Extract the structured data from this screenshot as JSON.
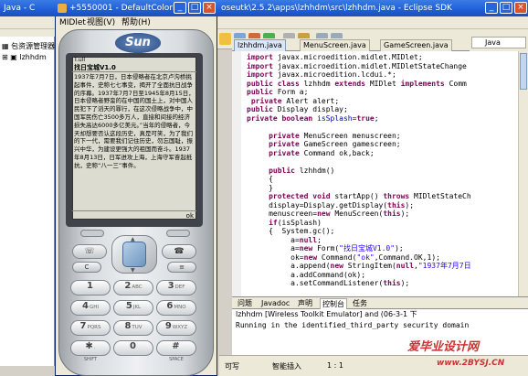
{
  "eclipse": {
    "title_left": "Java - C",
    "title_right": "oseutk\\2.5.2\\apps\\lzhhdm\\src\\lzhhdm.java - Eclipse SDK",
    "perspective_label": "Java",
    "package_tree": [
      {
        "label": "包资源管理器"
      },
      {
        "label": "lzhhdm"
      }
    ],
    "editor_tabs": [
      {
        "label": "lzhhdm.java",
        "active": true
      },
      {
        "label": "MenuScreen.java",
        "active": false
      },
      {
        "label": "GameScreen.java",
        "active": false
      }
    ],
    "code_lines": [
      {
        "segments": [
          {
            "k": "kw",
            "t": "import"
          },
          {
            "k": "",
            "t": " javax.microedition.midlet.MIDlet;"
          }
        ]
      },
      {
        "segments": [
          {
            "k": "kw",
            "t": "import"
          },
          {
            "k": "",
            "t": " javax.microedition.midlet.MIDletStateChange"
          }
        ]
      },
      {
        "segments": [
          {
            "k": "kw",
            "t": "import"
          },
          {
            "k": "",
            "t": " javax.microedition.lcdui.*;"
          }
        ]
      },
      {
        "segments": [
          {
            "k": "kw",
            "t": "public class"
          },
          {
            "k": "",
            "t": " lzhhdm "
          },
          {
            "k": "kw",
            "t": "extends"
          },
          {
            "k": "",
            "t": " MIDlet "
          },
          {
            "k": "kw",
            "t": "implements"
          },
          {
            "k": "",
            "t": " Comm"
          }
        ]
      },
      {
        "segments": [
          {
            "k": "kw",
            "t": "public"
          },
          {
            "k": "",
            "t": " Form a;"
          }
        ]
      },
      {
        "segments": [
          {
            "k": "",
            "t": " "
          },
          {
            "k": "kw",
            "t": "private"
          },
          {
            "k": "",
            "t": " Alert alert;"
          }
        ]
      },
      {
        "segments": [
          {
            "k": "kw",
            "t": "public"
          },
          {
            "k": "",
            "t": " Display display;"
          }
        ]
      },
      {
        "segments": [
          {
            "k": "kw",
            "t": "private boolean"
          },
          {
            "k": "fld",
            "t": " isSplash"
          },
          {
            "k": "",
            "t": "="
          },
          {
            "k": "kw",
            "t": "true"
          },
          {
            "k": "",
            "t": ";"
          }
        ]
      },
      {
        "segments": [
          {
            "k": "",
            "t": ""
          }
        ]
      },
      {
        "segments": [
          {
            "k": "",
            "t": "     "
          },
          {
            "k": "kw",
            "t": "private"
          },
          {
            "k": "",
            "t": " MenuScreen menuscreen;"
          }
        ]
      },
      {
        "segments": [
          {
            "k": "",
            "t": "     "
          },
          {
            "k": "kw",
            "t": "private"
          },
          {
            "k": "",
            "t": " GameScreen gamescreen;"
          }
        ]
      },
      {
        "segments": [
          {
            "k": "",
            "t": "     "
          },
          {
            "k": "kw",
            "t": "private"
          },
          {
            "k": "",
            "t": " Command ok,back;"
          }
        ]
      },
      {
        "segments": [
          {
            "k": "",
            "t": ""
          }
        ]
      },
      {
        "segments": [
          {
            "k": "",
            "t": "     "
          },
          {
            "k": "kw",
            "t": "public"
          },
          {
            "k": "",
            "t": " lzhhdm()"
          }
        ]
      },
      {
        "segments": [
          {
            "k": "",
            "t": "     {"
          }
        ]
      },
      {
        "segments": [
          {
            "k": "",
            "t": "     }"
          }
        ]
      },
      {
        "segments": [
          {
            "k": "",
            "t": "     "
          },
          {
            "k": "kw",
            "t": "protected void"
          },
          {
            "k": "",
            "t": " startApp() "
          },
          {
            "k": "kw",
            "t": "throws"
          },
          {
            "k": "",
            "t": " MIDletStateCh"
          }
        ]
      },
      {
        "segments": [
          {
            "k": "",
            "t": "     display=Display.getDisplay("
          },
          {
            "k": "kw",
            "t": "this"
          },
          {
            "k": "",
            "t": ");"
          }
        ]
      },
      {
        "segments": [
          {
            "k": "",
            "t": "     menuscreen="
          },
          {
            "k": "kw",
            "t": "new"
          },
          {
            "k": "",
            "t": " MenuScreen("
          },
          {
            "k": "kw",
            "t": "this"
          },
          {
            "k": "",
            "t": ");"
          }
        ]
      },
      {
        "segments": [
          {
            "k": "",
            "t": "     "
          },
          {
            "k": "kw",
            "t": "if"
          },
          {
            "k": "",
            "t": "(isSplash)"
          }
        ]
      },
      {
        "segments": [
          {
            "k": "",
            "t": "     {  System.gc();"
          }
        ]
      },
      {
        "segments": [
          {
            "k": "",
            "t": "          a="
          },
          {
            "k": "kw",
            "t": "null"
          },
          {
            "k": "",
            "t": ";"
          }
        ]
      },
      {
        "segments": [
          {
            "k": "",
            "t": "          a="
          },
          {
            "k": "kw",
            "t": "new"
          },
          {
            "k": "",
            "t": " Form("
          },
          {
            "k": "str",
            "t": "\"找日宝城V1.0\""
          },
          {
            "k": "",
            "t": ");"
          }
        ]
      },
      {
        "segments": [
          {
            "k": "",
            "t": "          ok="
          },
          {
            "k": "kw",
            "t": "new"
          },
          {
            "k": "",
            "t": " Command("
          },
          {
            "k": "str",
            "t": "\"ok\""
          },
          {
            "k": "",
            "t": ",Command.OK,1);"
          }
        ]
      },
      {
        "segments": [
          {
            "k": "",
            "t": "          a.append("
          },
          {
            "k": "kw",
            "t": "new"
          },
          {
            "k": "",
            "t": " StringItem("
          },
          {
            "k": "kw",
            "t": "null"
          },
          {
            "k": "",
            "t": ","
          },
          {
            "k": "str",
            "t": "\"1937年7月7日"
          }
        ]
      },
      {
        "segments": [
          {
            "k": "",
            "t": "          a.addCommand(ok);"
          }
        ]
      },
      {
        "segments": [
          {
            "k": "",
            "t": "          a.setCommandListener("
          },
          {
            "k": "kw",
            "t": "this"
          },
          {
            "k": "",
            "t": ");"
          }
        ]
      }
    ],
    "console_tabs": [
      {
        "label": "问题",
        "active": false
      },
      {
        "label": "Javadoc",
        "active": false
      },
      {
        "label": "声明",
        "active": false
      },
      {
        "label": "控制台",
        "active": true
      },
      {
        "label": "任务",
        "active": false
      }
    ],
    "console_header": "lzhhdm [Wireless Toolkit Emulator] and (06-3-1 下",
    "console_text": "Running in the identified_third_party security domain",
    "status": {
      "mode": "可写",
      "insert": "智能插入",
      "position": "1 : 1"
    }
  },
  "watermark": {
    "line1": "爱毕业设计网",
    "line2": "www.2BYSJ.CN"
  },
  "emulator": {
    "title": "+5550001 - DefaultColorP...",
    "menu": [
      "MIDlet",
      "视图(V)",
      "帮助(H)"
    ],
    "brand": "Sun",
    "screen": {
      "status": "T.ull",
      "title": "找日宝城V1.0",
      "body": "1937年7月7日，日本侵略者在北京卢沟桥挑起事件，史称七七事变，揭开了全面抗日战争的序幕。1937年7月7日至1945年8月15日，日本侵略者野蛮的在中国的国土上，对中国人民犯下了滔天的罪行，在这次侵略战争中，中国军民伤亡3500多万人，直接和间接的经济损失高达6000多亿美元。”当年的侵略者，今天却想要否认这段历史，真是可笑，为了我们的下一代，需要我们记住历史，勿忘国耻，振兴中华，为建设更强大的祖国而奋斗。1937年8月13日，日军进攻上海，上海守军奋起抵抗，史称“八一三”事件。",
      "softkey": "ok"
    },
    "keys": [
      {
        "n": "1",
        "l": "",
        "sub": ""
      },
      {
        "n": "2",
        "l": "ABC",
        "sub": ""
      },
      {
        "n": "3",
        "l": "DEF",
        "sub": ""
      },
      {
        "n": "4",
        "l": "GHI",
        "sub": ""
      },
      {
        "n": "5",
        "l": "JKL",
        "sub": ""
      },
      {
        "n": "6",
        "l": "MNO",
        "sub": ""
      },
      {
        "n": "7",
        "l": "PQRS",
        "sub": ""
      },
      {
        "n": "8",
        "l": "TUV",
        "sub": ""
      },
      {
        "n": "9",
        "l": "WXYZ",
        "sub": ""
      },
      {
        "n": "✱",
        "l": ".",
        "sub": "SHIFT"
      },
      {
        "n": "0",
        "l": "",
        "sub": ""
      },
      {
        "n": "#",
        "l": "",
        "sub": "SPACE"
      }
    ]
  },
  "colors": {
    "titlebar": "#1f5ed8",
    "keyword": "#7f0055",
    "string": "#2a00ff",
    "watermark": "#cc3333"
  }
}
